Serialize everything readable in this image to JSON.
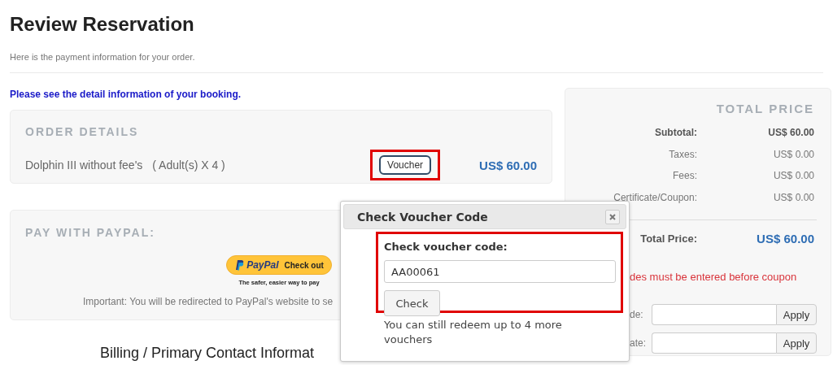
{
  "page": {
    "title": "Review Reservation",
    "subtitle": "Here is the payment information for your order."
  },
  "notice": "Please see the detail information of your booking.",
  "order": {
    "heading": "ORDER DETAILS",
    "item": "Dolphin III without fee's",
    "quantity": "( Adult(s) X 4 )",
    "voucher_button": "Voucher",
    "voucher_highlighted": true,
    "price": "US$ 60.00"
  },
  "paypal": {
    "heading": "PAY WITH PAYPAL:",
    "button_brand": "PayPal",
    "button_label": "Check out",
    "tagline": "The safer, easier way to pay",
    "note": "Important: You will be redirected to PayPal's website to se"
  },
  "billing": {
    "heading": "Billing / Primary Contact Informat"
  },
  "price_panel": {
    "heading": "TOTAL PRICE",
    "rows": [
      {
        "label": "Subtotal:",
        "value": "US$ 60.00",
        "bold": true
      },
      {
        "label": "Taxes:",
        "value": "US$ 0.00",
        "bold": false
      },
      {
        "label": "Fees:",
        "value": "US$ 0.00",
        "bold": false
      },
      {
        "label": "Certificate/Coupon:",
        "value": "US$ 0.00",
        "bold": false
      }
    ],
    "total": {
      "label": "Total Price:",
      "value": "US$ 60.00"
    },
    "warning": "des must be entered before coupon",
    "fields": [
      {
        "label": "de:",
        "button": "Apply"
      },
      {
        "label": "ate:",
        "button": "Apply"
      }
    ]
  },
  "voucher_dialog": {
    "title": "Check Voucher Code",
    "label": "Check voucher code:",
    "value": "AA00061",
    "button": "Check",
    "highlighted": true,
    "note": "You can still redeem up to 4 more vouchers"
  }
}
